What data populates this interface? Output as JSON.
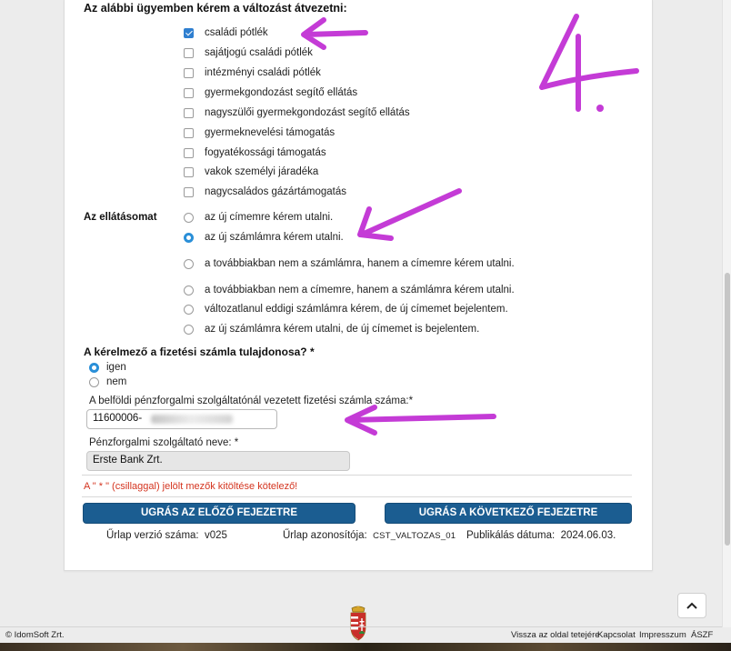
{
  "form": {
    "changes_heading": "Az alábbi ügyemben kérem a változást átvezetni:",
    "benefits": [
      {
        "label": "családi pótlék",
        "checked": true
      },
      {
        "label": "sajátjogú családi pótlék",
        "checked": false
      },
      {
        "label": "intézményi családi pótlék",
        "checked": false
      },
      {
        "label": "gyermekgondozást segítő ellátás",
        "checked": false
      },
      {
        "label": "nagyszülői gyermekgondozást segítő ellátás",
        "checked": false
      },
      {
        "label": "gyermeknevelési támogatás",
        "checked": false
      },
      {
        "label": "fogyatékossági támogatás",
        "checked": false
      },
      {
        "label": "vakok személyi járadéka",
        "checked": false
      },
      {
        "label": "nagycsaládos gázártámogatás",
        "checked": false
      }
    ],
    "payment_label": "Az ellátásomat",
    "payment_options": [
      {
        "label": "az új címemre kérem utalni.",
        "checked": false
      },
      {
        "label": "az új számlámra kérem utalni.",
        "checked": true
      },
      {
        "label": "a továbbiakban nem a számlámra, hanem a címemre kérem utalni.",
        "checked": false
      },
      {
        "label": "a továbbiakban nem a címemre, hanem a számlámra kérem utalni.",
        "checked": false
      },
      {
        "label": "változatlanul eddigi számlámra kérem, de új címemet bejelentem.",
        "checked": false
      },
      {
        "label": "az új számlámra kérem utalni, de új címemet is bejelentem.",
        "checked": false
      }
    ],
    "owner_question": "A kérelmező a fizetési számla tulajdonosa? *",
    "owner_options": [
      {
        "label": "igen",
        "checked": true
      },
      {
        "label": "nem",
        "checked": false
      }
    ],
    "account_label": "A belföldi pénzforgalmi szolgáltatónál vezetett fizetési számla száma:*",
    "account_value": "11600006-",
    "provider_label": "Pénzforgalmi szolgáltató neve: *",
    "provider_value": "Erste Bank Zrt.",
    "required_note": "A \" * \" (csillaggal) jelölt mezők kitöltése kötelező!"
  },
  "buttons": {
    "prev_label": "UGRÁS AZ ELŐZŐ FEJEZETRE",
    "next_label": "UGRÁS A KÖVETKEZŐ FEJEZETRE"
  },
  "meta": {
    "version_label": "Űrlap verzió száma:",
    "version_value": "v025",
    "id_label": "Űrlap azonosítója:",
    "id_value": "CST_VALTOZAS_01",
    "published_label": "Publikálás dátuma:",
    "published_value": "2024.06.03."
  },
  "footer": {
    "copyright": "© IdomSoft Zrt.",
    "links": [
      "Vissza az oldal tetejére",
      "Kapcsolat",
      "Impresszum",
      "ÁSZF"
    ]
  },
  "annotation": {
    "step_number": "4.",
    "color": "#c43bd6"
  },
  "colors": {
    "button_bg": "#1b5d91",
    "accent_blue": "#2a8fd8",
    "required_red": "#d4341f"
  }
}
